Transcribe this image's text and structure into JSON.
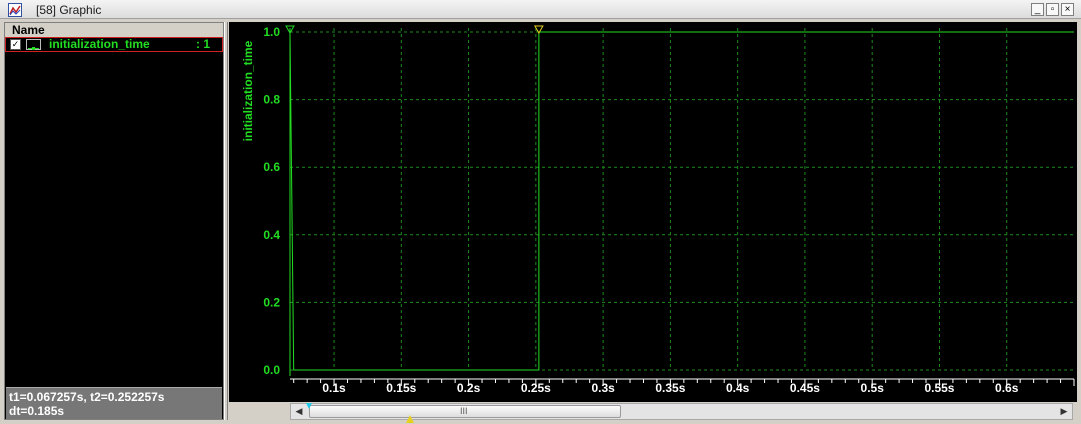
{
  "window": {
    "title": "[58] Graphic",
    "buttons": {
      "minimize": "_",
      "restore": "▫",
      "close": "×"
    }
  },
  "signal_list": {
    "header": "Name",
    "items": [
      {
        "checked": true,
        "name": "initialization_time",
        "value": ": 1",
        "color": "#22dd22",
        "selected": true
      }
    ]
  },
  "status": {
    "line1": "t1=0.067257s, t2=0.252257s",
    "line2": "dt=0.185s"
  },
  "scrollbar": {
    "grip": "III"
  },
  "colors": {
    "signal": "#22dd22",
    "grid": "#1f8a1f",
    "cursor1": "#22c8e6",
    "cursor2": "#e6d020",
    "background": "#000000"
  },
  "chart_data": {
    "type": "line",
    "ylabel": "initialization_time",
    "ylim": [
      0,
      1
    ],
    "xlim": [
      0.067257,
      0.65
    ],
    "y_ticks": [
      "0.0",
      "0.2",
      "0.4",
      "0.6",
      "0.8",
      "1.0"
    ],
    "y_tick_values": [
      0,
      0.2,
      0.4,
      0.6,
      0.8,
      1.0
    ],
    "x_ticks": [
      "0.1s",
      "0.15s",
      "0.2s",
      "0.25s",
      "0.3s",
      "0.35s",
      "0.4s",
      "0.45s",
      "0.5s",
      "0.55s",
      "0.6s"
    ],
    "x_tick_values": [
      0.1,
      0.15,
      0.2,
      0.25,
      0.3,
      0.35,
      0.4,
      0.45,
      0.5,
      0.55,
      0.6
    ],
    "series": [
      {
        "x": [
          0.067257,
          0.067257,
          0.07,
          0.252257,
          0.252257,
          0.65
        ],
        "y": [
          0,
          1,
          0,
          0,
          1,
          1
        ]
      }
    ],
    "cursors": [
      {
        "name": "t1",
        "x": 0.067257
      },
      {
        "name": "t2",
        "x": 0.252257
      }
    ],
    "grid": true
  }
}
